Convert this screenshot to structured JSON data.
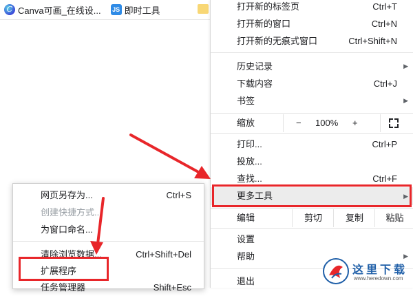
{
  "bookmarks": [
    {
      "label": "Canva可画_在线设...",
      "icon": "canva-icon"
    },
    {
      "label": "即时工具",
      "icon": "js-icon"
    }
  ],
  "menu": {
    "new_tab": {
      "label": "打开新的标签页",
      "shortcut": "Ctrl+T"
    },
    "new_window": {
      "label": "打开新的窗口",
      "shortcut": "Ctrl+N"
    },
    "incognito": {
      "label": "打开新的无痕式窗口",
      "shortcut": "Ctrl+Shift+N"
    },
    "history": {
      "label": "历史记录"
    },
    "downloads": {
      "label": "下载内容",
      "shortcut": "Ctrl+J"
    },
    "bookmarks": {
      "label": "书签"
    },
    "zoom": {
      "label": "缩放",
      "minus": "−",
      "value": "100%",
      "plus": "+"
    },
    "print": {
      "label": "打印...",
      "shortcut": "Ctrl+P"
    },
    "cast": {
      "label": "投放..."
    },
    "find": {
      "label": "查找...",
      "shortcut": "Ctrl+F"
    },
    "more_tools": {
      "label": "更多工具"
    },
    "edit": {
      "label": "编辑",
      "cut": "剪切",
      "copy": "复制",
      "paste": "粘贴"
    },
    "settings": {
      "label": "设置"
    },
    "help": {
      "label": "帮助"
    },
    "exit": {
      "label": "退出"
    }
  },
  "submenu": {
    "save_as": {
      "label": "网页另存为...",
      "shortcut": "Ctrl+S"
    },
    "create_shortcut": {
      "label": "创建快捷方式..."
    },
    "name_window": {
      "label": "为窗口命名..."
    },
    "clear_data": {
      "label": "清除浏览数据...",
      "shortcut": "Ctrl+Shift+Del"
    },
    "extensions": {
      "label": "扩展程序"
    },
    "task_manager": {
      "label": "任务管理器",
      "shortcut": "Shift+Esc"
    }
  },
  "colors": {
    "annotation": "#e8262a",
    "highlight_bg": "#ececec"
  },
  "watermark": {
    "title": "这里下载",
    "url": "www.heredown.com"
  }
}
